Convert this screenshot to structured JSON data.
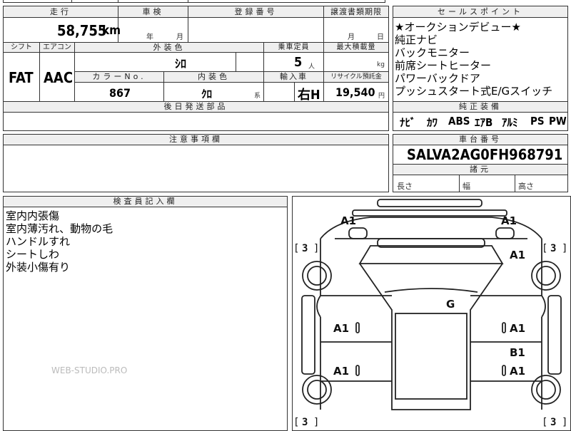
{
  "vehicle": {
    "mileage_label": "走行",
    "mileage": "58,755",
    "mileage_unit": "km",
    "inspection_label": "車検",
    "year_unit": "年",
    "month_unit": "月",
    "registration_label": "登録番号",
    "transfer_deadline_label": "譲渡書類期限",
    "transfer_month": "月",
    "transfer_day": "日",
    "shift_label": "シフト",
    "shift": "FAT",
    "ac_label": "エアコン",
    "ac": "AAC",
    "exterior_color_label": "外装色",
    "exterior_color": "ｼﾛ",
    "capacity_label": "乗車定員",
    "capacity": "5",
    "capacity_unit": "人",
    "max_load_label": "最大積載量",
    "max_load_unit": "kg",
    "color_no_label": "カラーNo.",
    "color_no": "867",
    "interior_color_label": "内装色",
    "interior_color": "ｸﾛ",
    "interior_suffix": "系",
    "import_label": "輸入車",
    "steering": "右H",
    "recycle_label": "リサイクル預託金",
    "recycle_amount": "19,540",
    "recycle_unit": "円",
    "later_parts_label": "後日発送部品",
    "cautions_label": "注意事項欄",
    "inspector_label": "検査員記入欄"
  },
  "sales_points": {
    "label": "セールスポイント",
    "lines": [
      "★オークションデビュー★",
      "純正ナビ",
      "バックモニター",
      "前席シートヒーター",
      "パワーバックドア",
      "プッシュスタート式E/Gスイッチ"
    ]
  },
  "equipment": {
    "label": "純正装備",
    "items": [
      "ﾅﾋﾞ",
      "ｶﾜ",
      "ABS",
      "ｴｱB",
      "ｱﾙﾐ",
      "PS",
      "PW"
    ]
  },
  "chassis": {
    "label": "車台番号",
    "number": "SALVA2AG0FH968791"
  },
  "dimensions": {
    "label": "諸元",
    "length": "長さ",
    "width": "幅",
    "height": "高さ"
  },
  "inspector_notes": [
    "室内内張傷",
    "室内薄汚れ、動物の毛",
    "ハンドルすれ",
    "シートしわ",
    "外装小傷有り"
  ],
  "diagram": {
    "marks": [
      "A1",
      "A1",
      "A1",
      "G",
      "A1",
      "A1",
      "A1",
      "B1",
      "A1"
    ],
    "tire_marks": [
      "3",
      "3",
      "3",
      "3"
    ]
  },
  "watermark": "WEB-STUDIO.PRO"
}
